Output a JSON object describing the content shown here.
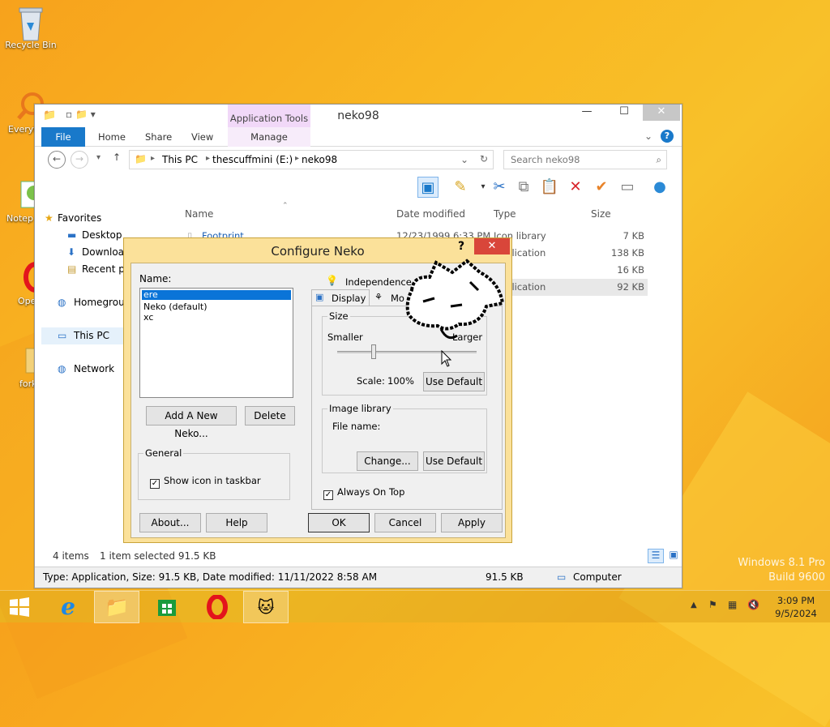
{
  "desktop": {
    "icons": [
      {
        "label": "Recycle Bin"
      },
      {
        "label": "Everyt"
      },
      {
        "label": "Notep"
      },
      {
        "label": "Ope"
      },
      {
        "label": "fork"
      }
    ],
    "watermark": {
      "line1": "Windows 8.1 Pro",
      "line2": "Build 9600"
    }
  },
  "explorer": {
    "title": "neko98",
    "context_tab": "Application Tools",
    "ribbon_tabs": [
      "File",
      "Home",
      "Share",
      "View",
      "Manage"
    ],
    "breadcrumb": [
      "This PC",
      "thescuffmini (E:)",
      "neko98"
    ],
    "search_placeholder": "Search neko98",
    "nav": {
      "favorites": "Favorites",
      "items": [
        "Desktop",
        "Downloads",
        "Recent places"
      ],
      "homegroup": "Homegroup",
      "this_pc": "This PC",
      "network": "Network"
    },
    "columns": [
      "Name",
      "Date modified",
      "Type",
      "Size"
    ],
    "files": [
      {
        "name": "Footprint",
        "date": "12/23/1999 6:33 PM",
        "type": "Icon library",
        "size": "7 KB"
      },
      {
        "name": "",
        "date": "",
        "type": "Application",
        "size": "138 KB"
      },
      {
        "name": "",
        "date": "",
        "type": "File",
        "size": "16 KB"
      },
      {
        "name": "",
        "date": "",
        "type": "Application",
        "size": "92 KB"
      }
    ],
    "status": {
      "count": "4 items",
      "selected": "1 item selected  91.5 KB"
    },
    "details": {
      "text": "Type: Application, Size: 91.5 KB, Date modified: 11/11/2022 8:58 AM",
      "size": "91.5 KB",
      "location": "Computer"
    }
  },
  "dialog": {
    "title": "Configure Neko",
    "name_label": "Name:",
    "names": [
      "ere",
      "Neko (default)",
      "xc"
    ],
    "add_button": "Add A New Neko...",
    "delete_button": "Delete",
    "general_label": "General",
    "show_icon_label": "Show icon in taskbar",
    "tabs": [
      "Independence",
      "Display",
      "Mo"
    ],
    "size_group": "Size",
    "smaller": "Smaller",
    "larger": "Larger",
    "scale_label": "Scale:",
    "scale_value": "100%",
    "use_default": "Use Default",
    "image_library_group": "Image library",
    "file_name_label": "File name:",
    "change_button": "Change...",
    "use_default2": "Use Default",
    "always_on_top": "Always On Top",
    "about_button": "About...",
    "help_button": "Help",
    "ok_button": "OK",
    "cancel_button": "Cancel",
    "apply_button": "Apply"
  },
  "taskbar": {
    "time": "3:09 PM",
    "date": "9/5/2024"
  }
}
